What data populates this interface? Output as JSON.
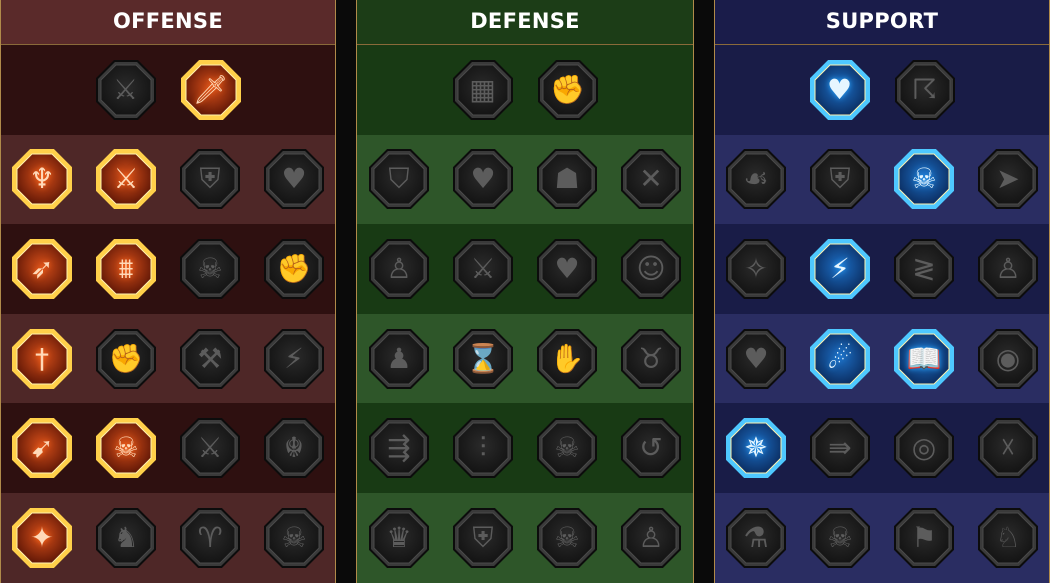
{
  "trees": [
    {
      "id": "offense",
      "title": "OFFENSE",
      "colors": {
        "header": "#5a2a2a",
        "row_dark": "#2e1010",
        "row_light": "#4e2727",
        "active_rim": "#ffd04a",
        "active_fill": "#d8501a"
      },
      "rows": [
        [
          {
            "icon": "crossed-swords-icon",
            "glyph": "⚔",
            "active": false
          },
          {
            "icon": "slashing-blade-icon",
            "glyph": "🗡",
            "active": true
          }
        ],
        [
          {
            "icon": "horned-demon-icon",
            "glyph": "♆",
            "active": true
          },
          {
            "icon": "flaming-sword-icon",
            "glyph": "⚔",
            "active": true
          },
          {
            "icon": "shield-strike-icon",
            "glyph": "⛨",
            "active": false
          },
          {
            "icon": "cracked-heart-icon",
            "glyph": "♥",
            "active": false
          }
        ],
        [
          {
            "icon": "arrow-pierced-figure-icon",
            "glyph": "➶",
            "active": true
          },
          {
            "icon": "fanged-maw-icon",
            "glyph": "⩩",
            "active": true
          },
          {
            "icon": "skull-slash-icon",
            "glyph": "☠",
            "active": false
          },
          {
            "icon": "grasping-hand-icon",
            "glyph": "✊",
            "active": false
          }
        ],
        [
          {
            "icon": "bleeding-sword-icon",
            "glyph": "†",
            "active": true
          },
          {
            "icon": "armored-fist-icon",
            "glyph": "✊",
            "active": false
          },
          {
            "icon": "battle-axe-icon",
            "glyph": "⚒",
            "active": false
          },
          {
            "icon": "lightning-chain-icon",
            "glyph": "⚡",
            "active": false
          }
        ],
        [
          {
            "icon": "arrows-burst-icon",
            "glyph": "➹",
            "active": true
          },
          {
            "icon": "triple-skull-icon",
            "glyph": "☠",
            "active": true
          },
          {
            "icon": "ringed-blade-icon",
            "glyph": "⚔",
            "active": false
          },
          {
            "icon": "reaching-figure-icon",
            "glyph": "☬",
            "active": false
          }
        ],
        [
          {
            "icon": "sparkling-sword-icon",
            "glyph": "✦",
            "active": true
          },
          {
            "icon": "knight-helm-icon",
            "glyph": "♞",
            "active": false
          },
          {
            "icon": "horned-warrior-icon",
            "glyph": "♈",
            "active": false
          },
          {
            "icon": "radiant-skull-icon",
            "glyph": "☠",
            "active": false
          }
        ]
      ]
    },
    {
      "id": "defense",
      "title": "DEFENSE",
      "colors": {
        "header": "#1c3d17",
        "row_dark": "#183a14",
        "row_light": "#2e5629",
        "active_rim": "#c8e86a",
        "active_fill": "#4a8a2a"
      },
      "rows": [
        [
          {
            "icon": "stacked-bricks-icon",
            "glyph": "▦",
            "active": false
          },
          {
            "icon": "raised-fist-icon",
            "glyph": "✊",
            "active": false
          }
        ],
        [
          {
            "icon": "chevron-shield-icon",
            "glyph": "⛉",
            "active": false
          },
          {
            "icon": "anatomical-heart-icon",
            "glyph": "♥",
            "active": false
          },
          {
            "icon": "stone-golem-icon",
            "glyph": "☗",
            "active": false
          },
          {
            "icon": "crossed-blades-icon",
            "glyph": "✕",
            "active": false
          }
        ],
        [
          {
            "icon": "leaping-figure-icon",
            "glyph": "♙",
            "active": false
          },
          {
            "icon": "sword-and-shield-icon",
            "glyph": "⚔",
            "active": false
          },
          {
            "icon": "heart-badge-icon",
            "glyph": "♥",
            "active": false
          },
          {
            "icon": "hooded-head-icon",
            "glyph": "☺",
            "active": false
          }
        ],
        [
          {
            "icon": "crowd-icon",
            "glyph": "♟",
            "active": false
          },
          {
            "icon": "hourglass-icon",
            "glyph": "⌛",
            "active": false
          },
          {
            "icon": "open-palm-icon",
            "glyph": "✋",
            "active": false
          },
          {
            "icon": "bull-head-icon",
            "glyph": "♉",
            "active": false
          }
        ],
        [
          {
            "icon": "dashing-figure-icon",
            "glyph": "⇶",
            "active": false
          },
          {
            "icon": "claw-marks-icon",
            "glyph": "⫶",
            "active": false
          },
          {
            "icon": "crowned-skull-icon",
            "glyph": "☠",
            "active": false
          },
          {
            "icon": "deflect-swoosh-icon",
            "glyph": "↺",
            "active": false
          }
        ],
        [
          {
            "icon": "flaming-titan-icon",
            "glyph": "♛",
            "active": false
          },
          {
            "icon": "winged-shield-icon",
            "glyph": "⛨",
            "active": false
          },
          {
            "icon": "shrouded-skull-icon",
            "glyph": "☠",
            "active": false
          },
          {
            "icon": "flexing-figure-icon",
            "glyph": "♙",
            "active": false
          }
        ]
      ]
    },
    {
      "id": "support",
      "title": "SUPPORT",
      "colors": {
        "header": "#1a1c4a",
        "row_dark": "#191c47",
        "row_light": "#2a2d62",
        "active_rim": "#4ec8ff",
        "active_fill": "#1d6fc6"
      },
      "rows": [
        [
          {
            "icon": "healing-heart-icon",
            "glyph": "♥",
            "active": true
          },
          {
            "icon": "spiral-wind-icon",
            "glyph": "☈",
            "active": false
          }
        ],
        [
          {
            "icon": "praying-hands-icon",
            "glyph": "☙",
            "active": false
          },
          {
            "icon": "aura-shield-icon",
            "glyph": "⛨",
            "active": false
          },
          {
            "icon": "ghostly-skull-icon",
            "glyph": "☠",
            "active": true
          },
          {
            "icon": "gliding-arrow-icon",
            "glyph": "➤",
            "active": false
          }
        ],
        [
          {
            "icon": "blessed-figure-icon",
            "glyph": "✧",
            "active": false
          },
          {
            "icon": "lightning-bolt-icon",
            "glyph": "⚡",
            "active": true
          },
          {
            "icon": "zigzag-cracks-icon",
            "glyph": "≷",
            "active": false
          },
          {
            "icon": "twin-figures-icon",
            "glyph": "♙",
            "active": false
          }
        ],
        [
          {
            "icon": "chained-heart-icon",
            "glyph": "♥",
            "active": false
          },
          {
            "icon": "comet-icon",
            "glyph": "☄",
            "active": true
          },
          {
            "icon": "open-book-icon",
            "glyph": "📖",
            "active": true
          },
          {
            "icon": "glaring-eyes-icon",
            "glyph": "◉",
            "active": false
          }
        ],
        [
          {
            "icon": "compass-star-icon",
            "glyph": "✵",
            "active": true
          },
          {
            "icon": "speed-boot-icon",
            "glyph": "⇛",
            "active": false
          },
          {
            "icon": "all-seeing-eye-icon",
            "glyph": "◎",
            "active": false
          },
          {
            "icon": "bound-figure-icon",
            "glyph": "☓",
            "active": false
          }
        ],
        [
          {
            "icon": "poison-flask-icon",
            "glyph": "⚗",
            "active": false
          },
          {
            "icon": "grim-skull-icon",
            "glyph": "☠",
            "active": false
          },
          {
            "icon": "banner-gauntlet-icon",
            "glyph": "⚑",
            "active": false
          },
          {
            "icon": "eagle-head-icon",
            "glyph": "♘",
            "active": false
          }
        ]
      ]
    }
  ]
}
